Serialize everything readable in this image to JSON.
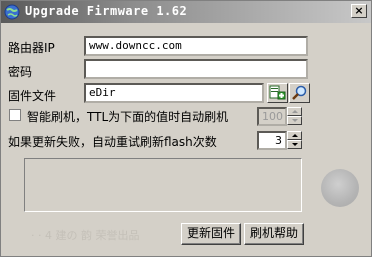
{
  "window": {
    "title": "Upgrade Firmware 1.62",
    "close_label": "×"
  },
  "form": {
    "router_ip_label": "路由器IP",
    "router_ip_value": "www.downcc.com",
    "password_label": "密码",
    "password_value": "",
    "firmware_file_label": "固件文件",
    "firmware_file_value": "eDir",
    "smart_flash_label": "智能刷机，TTL为下面的值时自动刷机",
    "smart_flash_checked": false,
    "ttl_value": "100",
    "retry_label": "如果更新失败，自动重试刷新flash次数",
    "retry_value": "3"
  },
  "footer": {
    "watermark_text": "· · 4 建の 韵  荣誉出品",
    "update_button": "更新固件",
    "help_button": "刷机帮助"
  },
  "icons": {
    "app": "globe-icon",
    "open_file": "add-file-icon",
    "browse": "magnifier-icon"
  },
  "colors": {
    "face": "#d4d0c8",
    "title_start": "#5a5a5a",
    "title_end": "#c8c8c8"
  }
}
